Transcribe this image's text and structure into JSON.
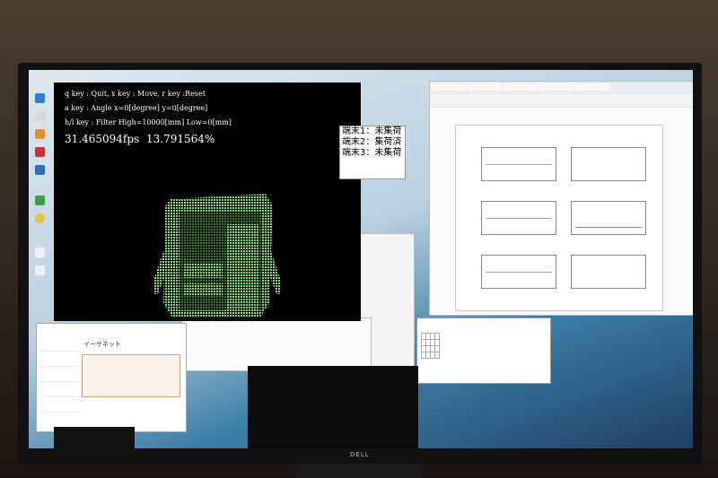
{
  "viewer": {
    "help_lines": [
      "q key : Quit, x key : Move, r key :Reset",
      "a key : Angle x=0[degree] y=0[degree]",
      "h/l key : Filter High=10000[mm] Low=0[mm]"
    ],
    "fps": "31.465094fps",
    "percent": "13.791564%"
  },
  "status_panel": {
    "items": [
      "端末1：未集荷",
      "端末2：集荷済",
      "端末3：未集荷"
    ]
  },
  "taskmgr": {
    "title": "イーサネット"
  },
  "monitor_brand": "DELL",
  "colors": {
    "cloud_green": "#7fe05a",
    "plot_line": "#9bbf4a"
  }
}
